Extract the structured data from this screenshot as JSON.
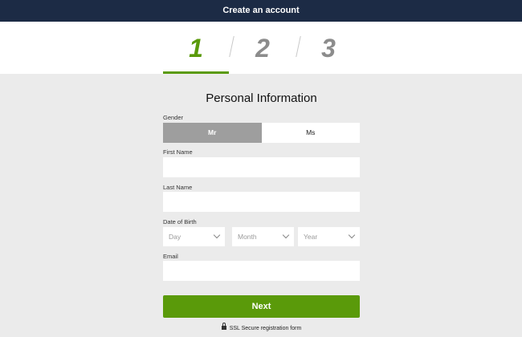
{
  "header": {
    "title": "Create an account"
  },
  "steps": {
    "items": [
      "1",
      "2",
      "3"
    ],
    "active": "1"
  },
  "form": {
    "title": "Personal Information",
    "gender": {
      "label": "Gender",
      "options": [
        "Mr",
        "Ms"
      ],
      "selected": "Mr"
    },
    "first_name": {
      "label": "First Name",
      "value": ""
    },
    "last_name": {
      "label": "Last Name",
      "value": ""
    },
    "dob": {
      "label": "Date of Birth",
      "day": "Day",
      "month": "Month",
      "year": "Year"
    },
    "email": {
      "label": "Email",
      "value": ""
    },
    "next_label": "Next",
    "ssl_text": "SSL Secure registration form"
  },
  "colors": {
    "header_bg": "#1c2b45",
    "accent": "#5a9a0a",
    "selected_bg": "#9e9e9e",
    "page_bg": "#ebebeb"
  },
  "icons": [
    "lock-icon",
    "chevron-down-icon"
  ]
}
